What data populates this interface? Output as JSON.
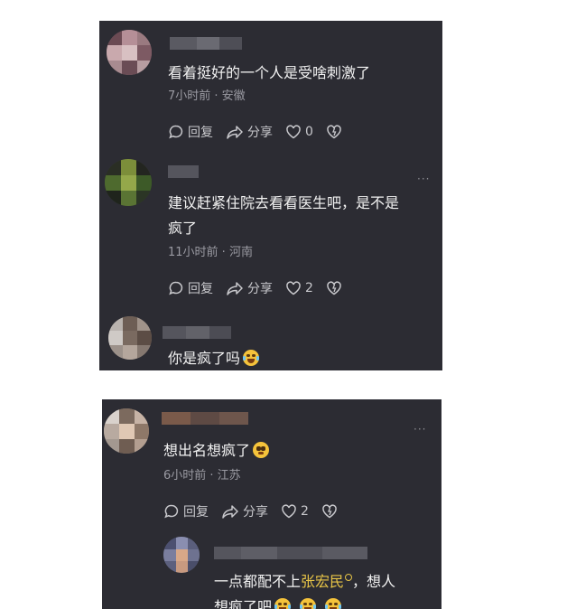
{
  "panel1": {
    "comment1": {
      "text": "看着挺好的一个人是受啥刺激了",
      "meta": "7小时前 · 安徽",
      "reply_label": "回复",
      "share_label": "分享",
      "like_count": "0"
    },
    "comment2": {
      "text_line1": "建议赶紧住院去看看医生吧，是不是",
      "text_line2": "疯了",
      "meta": "11小时前 · 河南",
      "reply_label": "回复",
      "share_label": "分享",
      "like_count": "2",
      "more": "···"
    },
    "comment3": {
      "text": "你是疯了吗"
    }
  },
  "panel2": {
    "comment1": {
      "text": "想出名想疯了",
      "meta": "6小时前 · 江苏",
      "reply_label": "回复",
      "share_label": "分享",
      "like_count": "2",
      "more": "···"
    },
    "reply1": {
      "text_prefix": "一点都配不上",
      "mention": "张宏民",
      "text_suffix": "，想人",
      "text_line2": "想疯了吧"
    }
  },
  "colors": {
    "panel_bg": "#2c2c33",
    "text": "#f2f2f2",
    "meta": "#9a9aa2",
    "mention": "#e8c547"
  },
  "icons": [
    "comment-icon",
    "share-icon",
    "like-icon",
    "dislike-icon",
    "search-icon",
    "laughing-tears-emoji",
    "pleading-emoji"
  ]
}
